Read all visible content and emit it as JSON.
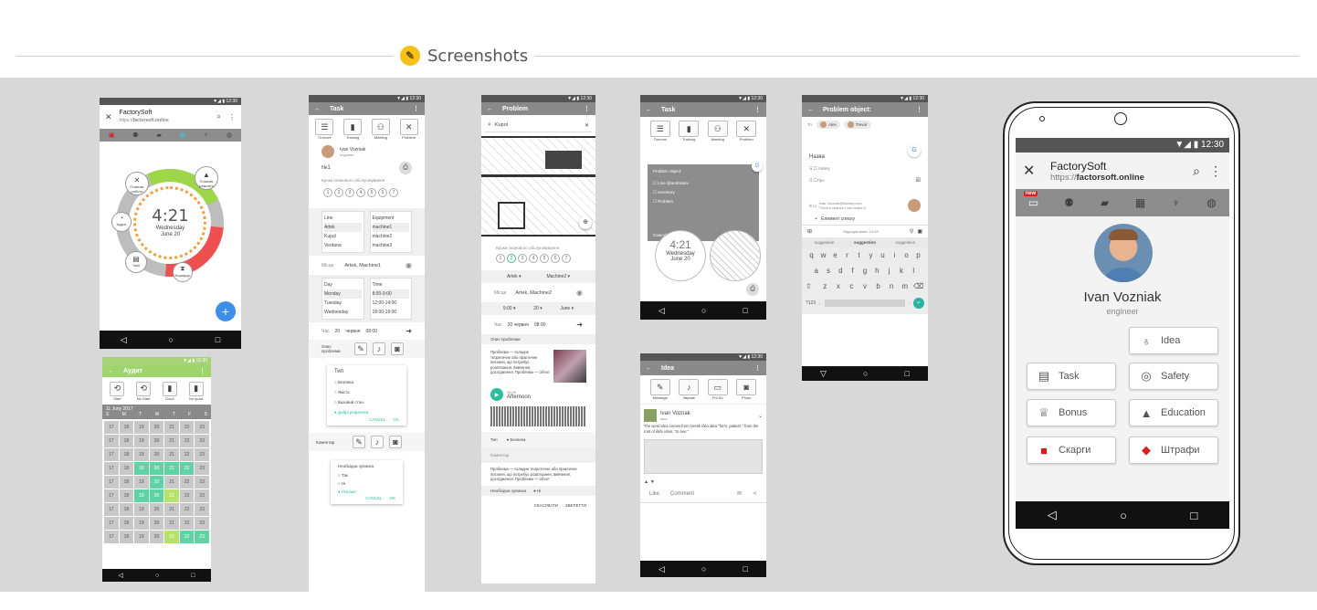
{
  "header": {
    "title": "Screenshots"
  },
  "phone1": {
    "status": "▼◢ ▮ 12:30",
    "app_title": "FactorySoft",
    "app_url_prefix": "https://",
    "app_url_domain": "factorsoft.online",
    "ring_labels": [
      "Планові роботи",
      "Планові ремонти",
      "Аудит",
      "Task",
      "Коридор",
      "Незаплановані роботи"
    ],
    "time": "4:21",
    "day": "Wednesday",
    "date": "June 20"
  },
  "phone2": {
    "status": "▼◢ ▮ 12:30",
    "title": "Аудит",
    "actions": [
      "Start",
      "No Start",
      "Good",
      "No good"
    ],
    "month": "11 Juny 2017",
    "weekdays": [
      "S",
      "M",
      "T",
      "W",
      "T",
      "F",
      "S"
    ]
  },
  "phone3": {
    "status": "▼◢ ▮ 12:30",
    "title": "Task",
    "tabs": [
      "Поточні",
      "Training",
      "Meeting",
      "Problem"
    ],
    "user_name": "Ivan Vozniak",
    "user_role": "engineer",
    "number": "№1",
    "steps_label": "Кроки планового обслуговування",
    "steps": [
      "1",
      "2",
      "3",
      "4",
      "5",
      "6",
      "7"
    ],
    "line_label": "Line",
    "equipment_label": "Equipment",
    "lines": [
      "Artek",
      "Kupol",
      "Verdana"
    ],
    "machines": [
      "machine1",
      "machine2",
      "machine3"
    ],
    "place_label": "Місце",
    "place_value": "Artek, Machine1",
    "day_label": "Day",
    "time_label": "Time",
    "days": [
      "Monday",
      "Tuesday",
      "Wednesday"
    ],
    "times": [
      "8:00-9:00",
      "12:00-14:00",
      "18:00-19:00"
    ],
    "hour_label": "Час",
    "hour_value": "20",
    "month_value": "червня",
    "clock_value": "08:00",
    "desc_label": "Опис проблеми",
    "type_label": "Тип",
    "types": [
      "Безпека",
      "Якість",
      "Базовий стан",
      "Добрі рефлекси"
    ],
    "cancel": "CANCEL",
    "ok": "OK",
    "comment_label": "Коментар",
    "stop_label": "Необхідна зупинка",
    "stop_options": [
      "Так",
      "Ні",
      "Пізніше"
    ]
  },
  "phone4": {
    "status": "▼◢ ▮ 12:30",
    "title": "Problem",
    "search": "Kupol",
    "steps_label": "Кроки планового обслуговування",
    "steps": [
      "1",
      "2",
      "3",
      "4",
      "5",
      "6",
      "7"
    ],
    "line": "Artek",
    "machine": "Machine2",
    "place_label": "Місце",
    "place_value": "Artek, Machine2",
    "time_a": "9:00",
    "time_b": "20",
    "time_c": "June",
    "hour_label": "Час",
    "date_value": "20 червня",
    "clock_value": "08:00",
    "desc_label": "Опис проблеми",
    "desc_text": "Проблема — складне теоретичне або практичне питання, що потребує розв'язання, вивчення, дослідження. Проблема — об'єкт",
    "audio_num": "08:40",
    "audio_title": "Afternoon",
    "type_label": "Тип",
    "type_value": "Безпека",
    "comment_label": "Коментар",
    "comment_text": "Проблема — складне теоретичне або практичне питання, що потребує розв'язання, вивчення, дослідження. Проблема — об'єкт",
    "stop_label": "Необхідна зупинка",
    "stop_value": "Ні",
    "cancel": "СКАСУВАТИ",
    "save": "ЗБЕРЕГТИ"
  },
  "phone5": {
    "status": "▼◢ ▮ 12:30",
    "title": "Task",
    "tabs": [
      "Поточні",
      "Training",
      "Meeting",
      "Problem"
    ],
    "card_title": "Problem object:",
    "card_items": [
      "Line @andrissev",
      "Inventory",
      "Problem"
    ],
    "calendar_label": "Calendar",
    "time": "4:21",
    "day": "Wednesday",
    "date": "June 20"
  },
  "phone6": {
    "status": "▼◢ ▮ 12:30",
    "title": "Idea",
    "tabs": [
      "Message",
      "Звукові",
      "Pril So",
      "Photo"
    ],
    "user_name": "Ivan Voznak",
    "user_sub": "idea",
    "text": "The word idea comes from Greek ἰδέα idea \"form, pattern,\" from the root of ἰδεῖν idein, \"to see.\"",
    "like": "Like",
    "comment": "Comment"
  },
  "phone7": {
    "status": "▼◢ ▮ 12:30",
    "title": "Problem object:",
    "to_label": "To:",
    "recipients": [
      "Alex",
      "Trevor"
    ],
    "name_label": "Назва",
    "items": [
      "Safety",
      "Про"
    ],
    "email": "Ivan.Vozniak@factory.com",
    "email_sub": "There's chance I can make it",
    "add_label": "Елемент списку",
    "edited": "Відредаговано 13:28",
    "suggestions": [
      "suggestion",
      "suggestion",
      "suggestion"
    ],
    "kbd_rows": [
      [
        "q",
        "w",
        "e",
        "r",
        "t",
        "y",
        "u",
        "i",
        "o",
        "p"
      ],
      [
        "a",
        "s",
        "d",
        "f",
        "g",
        "h",
        "j",
        "k",
        "l"
      ],
      [
        "z",
        "x",
        "c",
        "v",
        "b",
        "n",
        "m"
      ]
    ],
    "kbd_num": "?123"
  },
  "big": {
    "status": "▼◢ ▮ 12:30",
    "app_title": "FactorySoft",
    "app_url_prefix": "https://",
    "app_url_domain": "factorsoft.online",
    "new_badge": "new",
    "name": "Ivan Vozniak",
    "role": "engineer",
    "buttons": {
      "idea": "Idea",
      "task": "Task",
      "safety": "Safety",
      "bonus": "Bonus",
      "education": "Education",
      "complaints": "Скарги",
      "fines": "Штрафи"
    }
  }
}
